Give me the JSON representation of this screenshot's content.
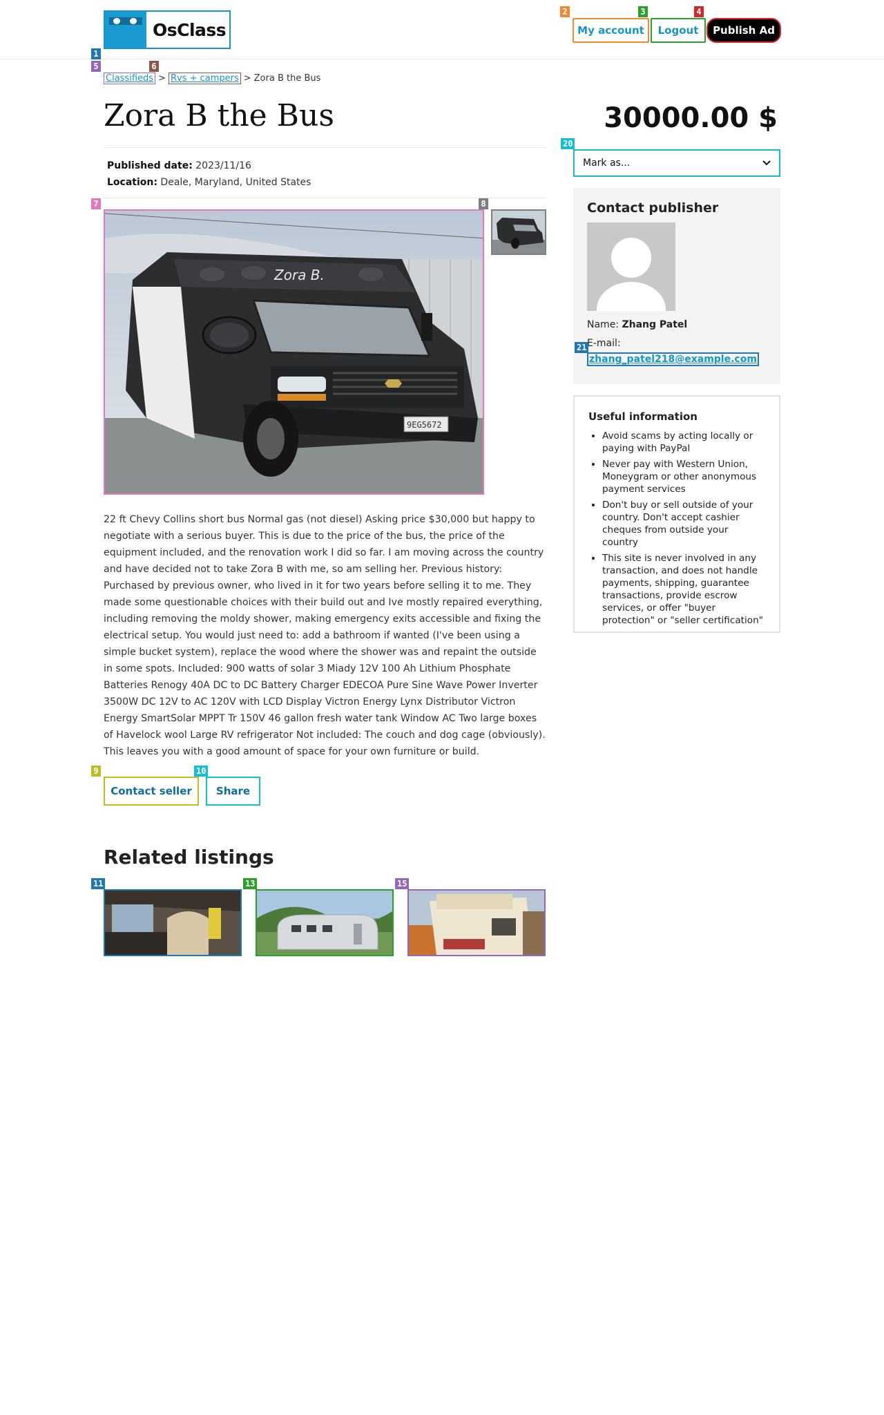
{
  "header": {
    "logo_text": "OsClass",
    "my_account": "My account",
    "logout": "Logout",
    "publish_ad": "Publish Ad"
  },
  "breadcrumb": {
    "items": [
      "Classifieds",
      "Rvs + campers"
    ],
    "separator": ">",
    "current": "Zora B the Bus"
  },
  "listing": {
    "title": "Zora B the Bus",
    "price": "30000.00 $",
    "published_label": "Published date:",
    "published_value": "2023/11/16",
    "location_label": "Location:",
    "location_value": "Deale, Maryland, United States",
    "bus_text": "Zora B.",
    "plate": "9EG5672",
    "description": "22 ft Chevy Collins short bus Normal gas (not diesel) Asking price $30,000 but happy to negotiate with a serious buyer. This is due to the price of the bus, the price of the equipment included, and the renovation work I did so far. I am moving across the country and have decided not to take Zora B with me, so am selling her. Previous history: Purchased by previous owner, who lived in it for two years before selling it to me. They made some questionable choices with their build out and Ive mostly repaired everything, including removing the moldy shower, making emergency exits accessible and fixing the electrical setup. You would just need to: add a bathroom if wanted (I've been using a simple bucket system), replace the wood where the shower was and repaint the outside in some spots. Included: 900 watts of solar 3 Miady 12V 100 Ah Lithium Phosphate Batteries Renogy 40A DC to DC Battery Charger EDECOA Pure Sine Wave Power Inverter 3500W DC 12V to AC 120V with LCD Display Victron Energy Lynx Distributor Victron Energy SmartSolar MPPT Tr 150V 46 gallon fresh water tank Window AC Two large boxes of Havelock wool Large RV refrigerator Not included: The couch and dog cage (obviously). This leaves you with a good amount of space for your own furniture or build.",
    "contact_seller": "Contact seller",
    "share": "Share"
  },
  "related": {
    "heading": "Related listings"
  },
  "sidebar": {
    "mark_as": "Mark as...",
    "contact_title": "Contact publisher",
    "name_label": "Name:",
    "name_value": "Zhang Patel",
    "email_label": "E-mail:",
    "email_value": "zhang_patel218@example.com",
    "useful_title": "Useful information",
    "useful_items": [
      "Avoid scams by acting locally or paying with PayPal",
      "Never pay with Western Union, Moneygram or other anonymous payment services",
      "Don't buy or sell outside of your country. Don't accept cashier cheques from outside your country",
      "This site is never involved in any transaction, and does not handle payments, shipping, guarantee transactions, provide escrow services, or offer \"buyer protection\" or \"seller certification\""
    ]
  },
  "markers": [
    "1",
    "2",
    "3",
    "4",
    "5",
    "6",
    "7",
    "8",
    "9",
    "10",
    "11",
    "13",
    "15",
    "20",
    "21"
  ],
  "colors": {
    "accent": "#1795c7",
    "publish_bg": "#000000",
    "sidebar_bg": "#f4f4f2"
  }
}
